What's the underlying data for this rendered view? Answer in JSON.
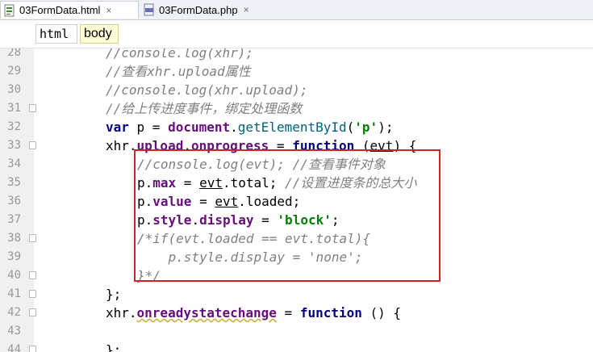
{
  "tabs": [
    {
      "label": "03FormData.html",
      "icon": "html-file-icon"
    },
    {
      "label": "03FormData.php",
      "icon": "php-file-icon"
    }
  ],
  "tab_close_glyph": "×",
  "breadcrumb": [
    "html",
    "body"
  ],
  "colors": {
    "highlight_box": "#d2232a",
    "comment": "#808080",
    "keyword": "#000080",
    "string": "#008000"
  },
  "lines": [
    {
      "num": "28",
      "fold": false,
      "segs": [
        {
          "t": "//console.log(xhr);",
          "c": "cm"
        }
      ]
    },
    {
      "num": "29",
      "fold": false,
      "segs": [
        {
          "t": "//查看xhr.upload属性",
          "c": "cm"
        }
      ]
    },
    {
      "num": "30",
      "fold": false,
      "segs": [
        {
          "t": "//console.log(xhr.upload);",
          "c": "cm"
        }
      ]
    },
    {
      "num": "31",
      "fold": true,
      "segs": [
        {
          "t": "//给上传进度事件，绑定处理函数",
          "c": "cm"
        }
      ]
    },
    {
      "num": "32",
      "fold": false,
      "segs": [
        {
          "t": "var",
          "c": "kw"
        },
        {
          "t": " p = ",
          "c": ""
        },
        {
          "t": "document",
          "c": "prop"
        },
        {
          "t": ".",
          "c": ""
        },
        {
          "t": "getElementById",
          "c": "fn"
        },
        {
          "t": "(",
          "c": ""
        },
        {
          "t": "'p'",
          "c": "str"
        },
        {
          "t": ");",
          "c": ""
        }
      ]
    },
    {
      "num": "33",
      "fold": true,
      "segs": [
        {
          "t": "xhr.",
          "c": ""
        },
        {
          "t": "upload",
          "c": "prop"
        },
        {
          "t": ".",
          "c": ""
        },
        {
          "t": "onprogress",
          "c": "prop"
        },
        {
          "t": " = ",
          "c": ""
        },
        {
          "t": "function",
          "c": "kw"
        },
        {
          "t": " (",
          "c": ""
        },
        {
          "t": "evt",
          "c": "ul"
        },
        {
          "t": ") {",
          "c": ""
        }
      ]
    },
    {
      "num": "34",
      "fold": false,
      "segs": [
        {
          "t": "//console.log(evt); //查看事件对象",
          "c": "cm"
        }
      ]
    },
    {
      "num": "35",
      "fold": false,
      "segs": [
        {
          "t": "p.",
          "c": ""
        },
        {
          "t": "max",
          "c": "prop"
        },
        {
          "t": " = ",
          "c": ""
        },
        {
          "t": "evt",
          "c": "ul"
        },
        {
          "t": ".total; ",
          "c": ""
        },
        {
          "t": "//设置进度条的总大小",
          "c": "cm"
        }
      ]
    },
    {
      "num": "36",
      "fold": false,
      "segs": [
        {
          "t": "p.",
          "c": ""
        },
        {
          "t": "value",
          "c": "prop"
        },
        {
          "t": " = ",
          "c": ""
        },
        {
          "t": "evt",
          "c": "ul"
        },
        {
          "t": ".loaded;",
          "c": ""
        }
      ]
    },
    {
      "num": "37",
      "fold": false,
      "segs": [
        {
          "t": "p.",
          "c": ""
        },
        {
          "t": "style",
          "c": "prop"
        },
        {
          "t": ".",
          "c": ""
        },
        {
          "t": "display",
          "c": "prop"
        },
        {
          "t": " = ",
          "c": ""
        },
        {
          "t": "'block'",
          "c": "str"
        },
        {
          "t": ";",
          "c": ""
        }
      ]
    },
    {
      "num": "38",
      "fold": true,
      "segs": [
        {
          "t": "/*if(evt.loaded == evt.total){",
          "c": "cm"
        }
      ]
    },
    {
      "num": "39",
      "fold": false,
      "segs": [
        {
          "t": "    p.style.display = 'none';",
          "c": "cm"
        }
      ]
    },
    {
      "num": "40",
      "fold": true,
      "segs": [
        {
          "t": "}*/",
          "c": "cm"
        }
      ]
    },
    {
      "num": "41",
      "fold": true,
      "segs": [
        {
          "t": "};",
          "c": ""
        }
      ]
    },
    {
      "num": "42",
      "fold": true,
      "segs": [
        {
          "t": "xhr.",
          "c": ""
        },
        {
          "t": "onreadystatechange",
          "c": "prop wav"
        },
        {
          "t": " = ",
          "c": ""
        },
        {
          "t": "function",
          "c": "kw"
        },
        {
          "t": " () {",
          "c": ""
        }
      ]
    },
    {
      "num": "43",
      "fold": false,
      "segs": []
    },
    {
      "num": "44",
      "fold": true,
      "segs": [
        {
          "t": "};",
          "c": ""
        }
      ]
    }
  ]
}
